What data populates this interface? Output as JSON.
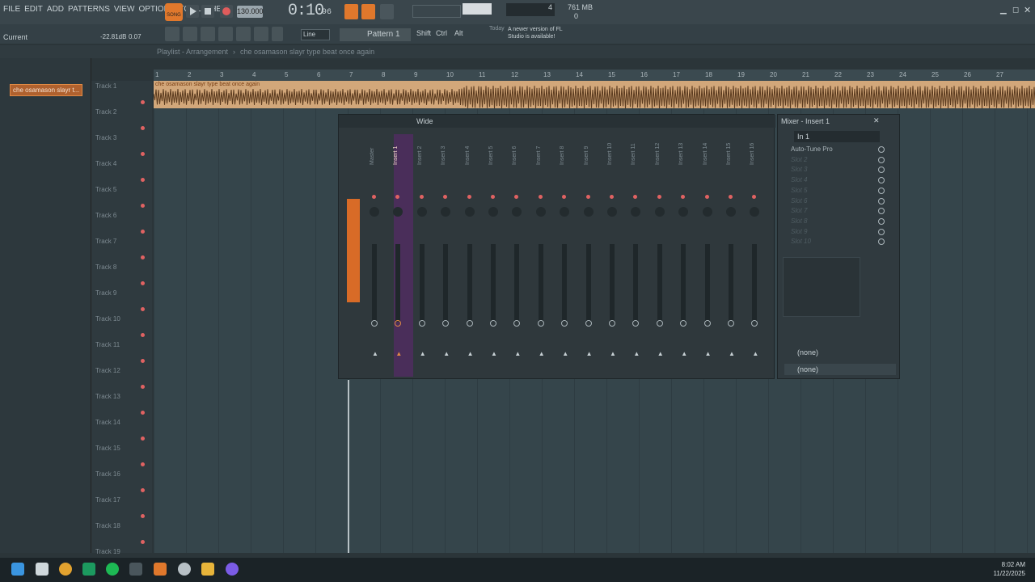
{
  "menu": [
    "FILE",
    "EDIT",
    "ADD",
    "PATTERNS",
    "VIEW",
    "OPTIONS",
    "TOOLS",
    "HELP"
  ],
  "transport": {
    "mode": "SONG",
    "tempo": "130.000",
    "time": "0:10",
    "time_small": "96",
    "memory": "761 MB",
    "cpu": "4",
    "zero": "0"
  },
  "hint": {
    "current": "Current",
    "db": "-22.81dB",
    "val": "0.07"
  },
  "toolbar": {
    "line_label": "Line",
    "pattern_label": "Pattern 1",
    "shift": "Shift",
    "ctrl": "Ctrl",
    "alt": "Alt",
    "news_today": "Today",
    "news_msg": "A newer version of FL Studio is available!"
  },
  "playlist": {
    "breadcrumb": "Playlist - Arrangement",
    "sep": "›",
    "pattern": "che osamason slayr type beat once again",
    "picker_item": "che osamason slayr t..."
  },
  "ruler": [
    "1",
    "2",
    "3",
    "4",
    "5",
    "6",
    "7",
    "8",
    "9",
    "10",
    "11",
    "12",
    "13",
    "14",
    "15",
    "16",
    "17",
    "18",
    "19",
    "20",
    "21",
    "22",
    "23",
    "24",
    "25",
    "26",
    "27"
  ],
  "tracks": [
    "Track 1",
    "Track 2",
    "Track 3",
    "Track 4",
    "Track 5",
    "Track 6",
    "Track 7",
    "Track 8",
    "Track 9",
    "Track 10",
    "Track 11",
    "Track 12",
    "Track 13",
    "Track 14",
    "Track 15",
    "Track 16",
    "Track 17",
    "Track 18",
    "Track 19"
  ],
  "clip_title": "che osamason slayr type beat once again",
  "mixer": {
    "mode": "Wide",
    "channels": [
      "Master",
      "Insert 1",
      "Insert 2",
      "Insert 3",
      "Insert 4",
      "Insert 5",
      "Insert 6",
      "Insert 7",
      "Insert 8",
      "Insert 9",
      "Insert 10",
      "Insert 11",
      "Insert 12",
      "Insert 13",
      "Insert 14",
      "Insert 15",
      "Insert 16"
    ]
  },
  "insert": {
    "title": "Mixer - Insert 1",
    "input": "In 1",
    "slots": [
      "Auto-Tune Pro",
      "Slot 2",
      "Slot 3",
      "Slot 4",
      "Slot 5",
      "Slot 6",
      "Slot 7",
      "Slot 8",
      "Slot 9",
      "Slot 10"
    ],
    "out1": "(none)",
    "out2": "(none)"
  },
  "clock": {
    "time": "8:02 AM",
    "date": "11/22/2025"
  }
}
